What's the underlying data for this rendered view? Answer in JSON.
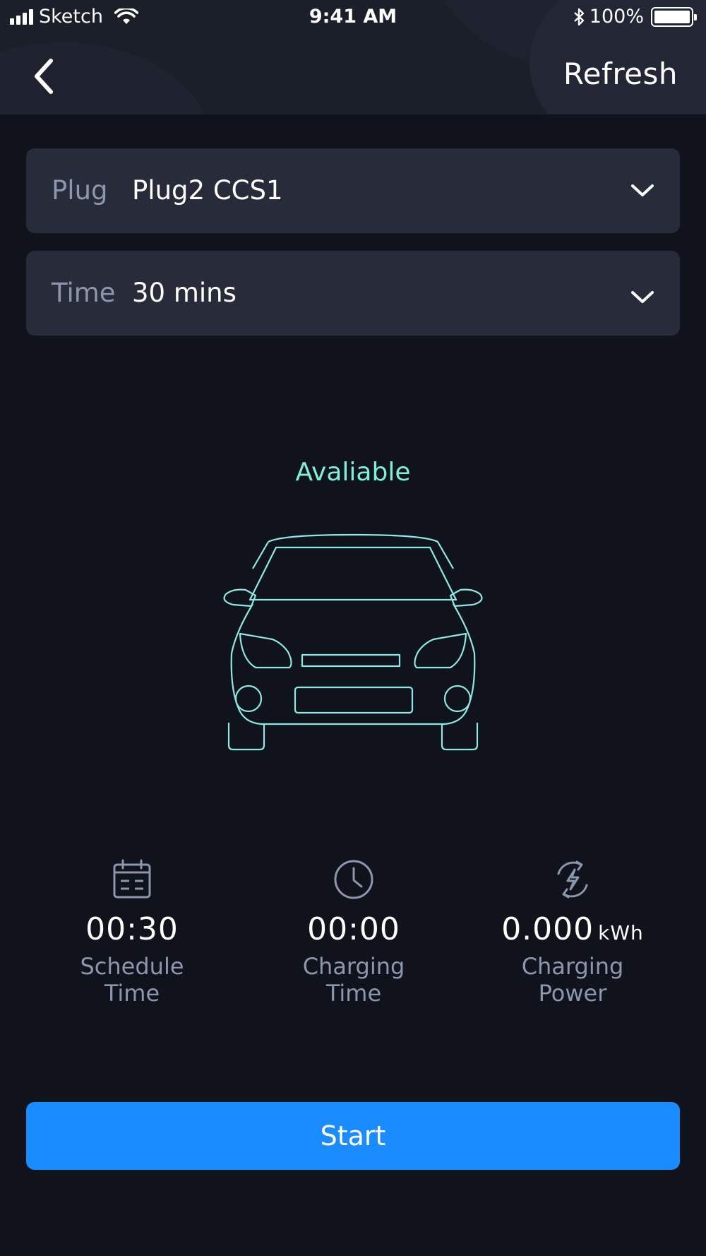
{
  "status_bar": {
    "carrier": "Sketch",
    "time": "9:41 AM",
    "battery": "100%"
  },
  "header": {
    "back_icon": "chevron-left-icon",
    "refresh_label": "Refresh"
  },
  "plug_select": {
    "label": "Plug",
    "value": "Plug2 CCS1"
  },
  "time_select": {
    "label": "Time",
    "value": "30 mins"
  },
  "status": {
    "text": "Avaliable",
    "color": "#7ff0d8"
  },
  "stats": {
    "schedule": {
      "icon": "calendar-icon",
      "value": "00:30",
      "caption": "Schedule Time"
    },
    "charging_time": {
      "icon": "clock-icon",
      "value": "00:00",
      "caption": "Charging Time"
    },
    "charging_power": {
      "icon": "charging-bolt-icon",
      "value": "0.000",
      "unit": "kWh",
      "caption": "Charging Power"
    }
  },
  "start_button": {
    "label": "Start",
    "color": "#1a8cff"
  }
}
